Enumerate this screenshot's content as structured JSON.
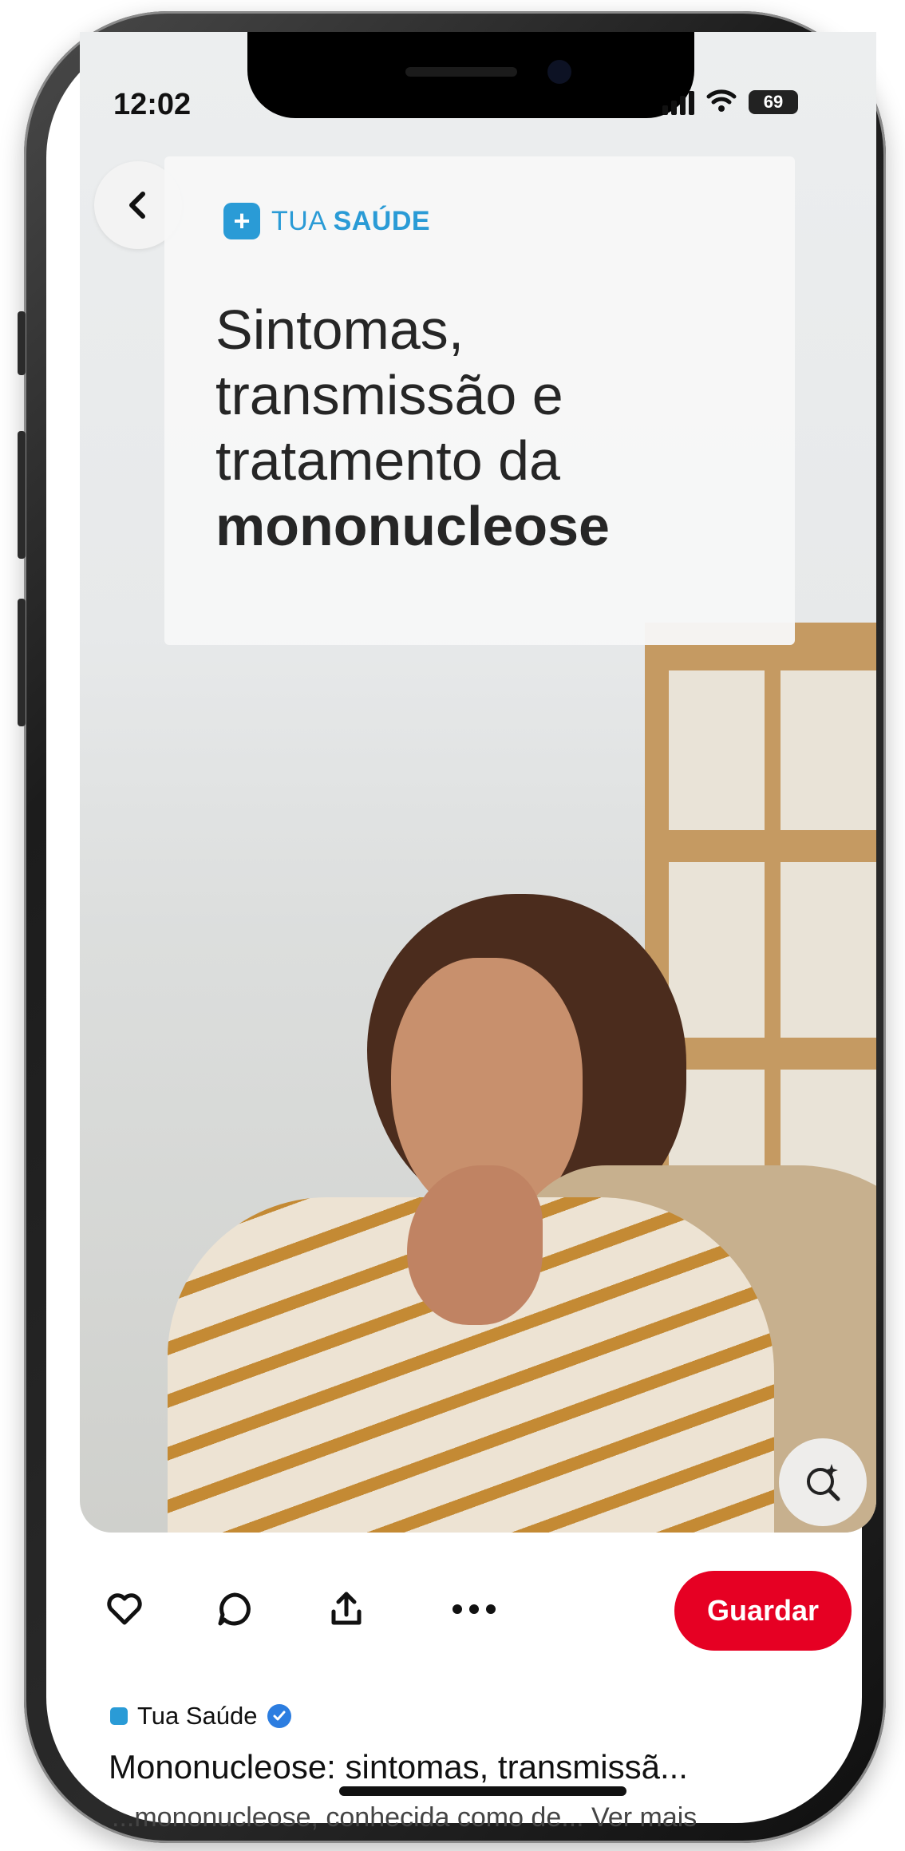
{
  "status_bar": {
    "time": "12:02",
    "battery": "69"
  },
  "article_card": {
    "brand_prefix": "TUA ",
    "brand_suffix": "SAÚDE",
    "headline_line1": "Sintomas,",
    "headline_line2": "transmissão e",
    "headline_line3": "tratamento da",
    "headline_bold": "mononucleose"
  },
  "actions": {
    "save_label": "Guardar"
  },
  "pin": {
    "creator_name": "Tua Saúde",
    "title": "Mononucleose: sintomas, transmissã...",
    "description": "...mononucleose, conhecida como de... Ver mais"
  },
  "colors": {
    "brand": "#2a9bd6",
    "save_button": "#e60023",
    "verified": "#2c7de0"
  },
  "icons": [
    "back-arrow-icon",
    "heart-icon",
    "comment-icon",
    "share-icon",
    "more-icon",
    "visual-search-icon",
    "verified-icon",
    "signal-icon",
    "wifi-icon",
    "battery-icon"
  ]
}
